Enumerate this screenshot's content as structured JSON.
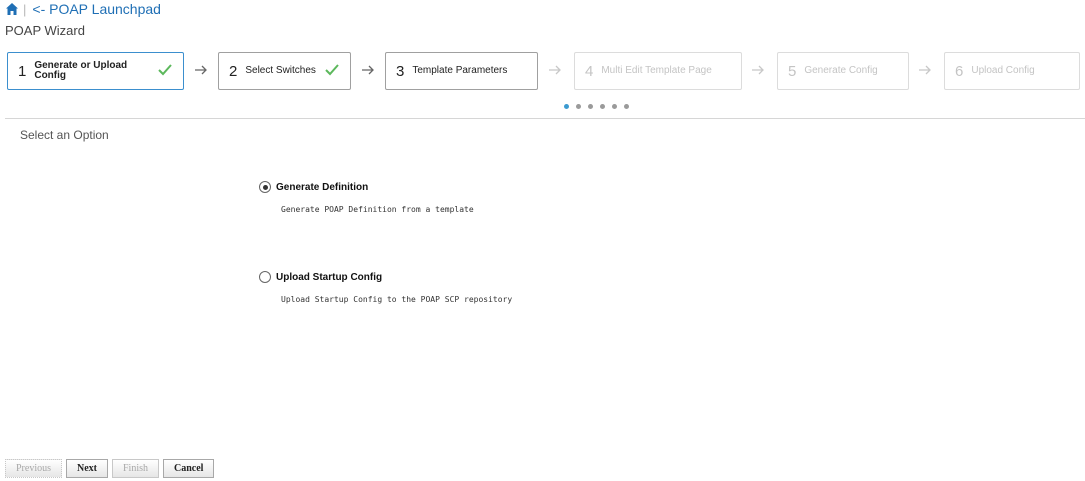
{
  "nav": {
    "separator": "|",
    "launchpad_link": "<- POAP Launchpad"
  },
  "wizard": {
    "title": "POAP Wizard",
    "steps": [
      {
        "num": "1",
        "label": "Generate or Upload Config",
        "state": "active",
        "completed": true
      },
      {
        "num": "2",
        "label": "Select Switches",
        "state": "done",
        "completed": true
      },
      {
        "num": "3",
        "label": "Template Parameters",
        "state": "done",
        "completed": false
      },
      {
        "num": "4",
        "label": "Multi Edit Template Page",
        "state": "disabled",
        "completed": false
      },
      {
        "num": "5",
        "label": "Generate Config",
        "state": "disabled",
        "completed": false
      },
      {
        "num": "6",
        "label": "Upload Config",
        "state": "disabled",
        "completed": false
      }
    ],
    "page_indicator": {
      "total": 6,
      "current": 1
    }
  },
  "content": {
    "section_title": "Select an Option",
    "options": [
      {
        "label": "Generate Definition",
        "description": "Generate POAP Definition from a template",
        "selected": true
      },
      {
        "label": "Upload Startup Config",
        "description": "Upload Startup Config to the POAP SCP repository",
        "selected": false
      }
    ]
  },
  "footer": {
    "previous": "Previous",
    "next": "Next",
    "finish": "Finish",
    "cancel": "Cancel"
  },
  "colors": {
    "accent": "#3b8fce",
    "link": "#1f6fb5",
    "check": "#5cb85c"
  }
}
